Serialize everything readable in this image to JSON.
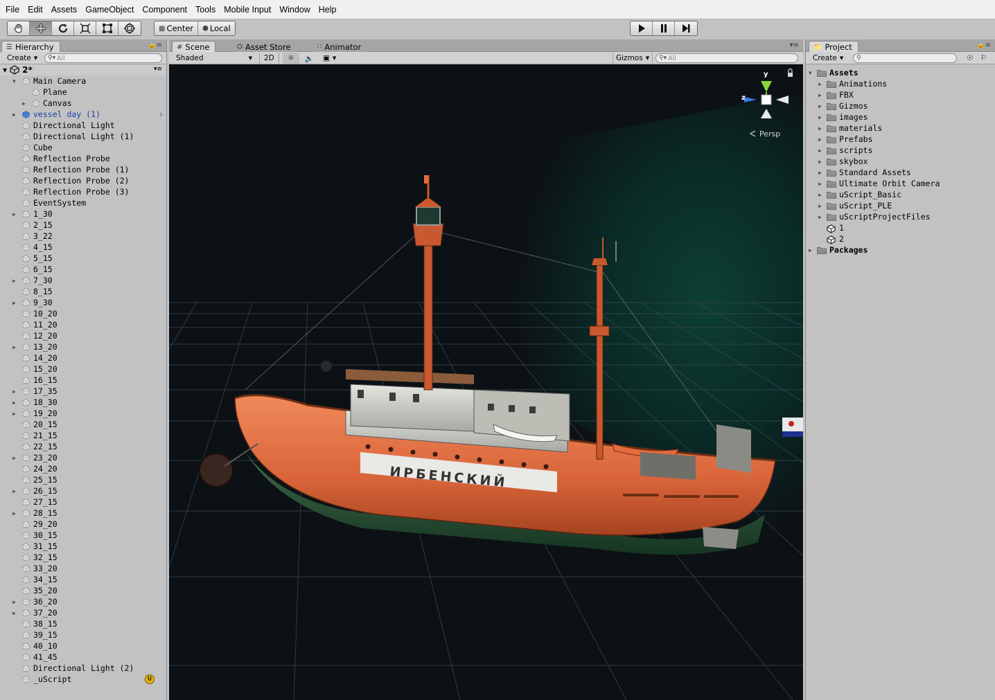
{
  "menu": [
    "File",
    "Edit",
    "Assets",
    "GameObject",
    "Component",
    "Tools",
    "Mobile Input",
    "Window",
    "Help"
  ],
  "toolbar": {
    "tools": [
      "hand-icon",
      "move-icon",
      "rotate-icon",
      "scale-icon",
      "rect-icon",
      "transform-icon"
    ],
    "pivot": "Center",
    "space": "Local",
    "playback": [
      "play-icon",
      "pause-icon",
      "step-icon"
    ]
  },
  "hierarchy": {
    "tab": "Hierarchy",
    "create": "Create",
    "search_placeholder": "All",
    "scene_name": "2*",
    "items": [
      {
        "label": "Main Camera",
        "depth": 0,
        "fold": "open"
      },
      {
        "label": "Plane",
        "depth": 1,
        "fold": ""
      },
      {
        "label": "Canvas",
        "depth": 1,
        "fold": "closed"
      },
      {
        "label": "vessel day (1)",
        "depth": 0,
        "fold": "closed",
        "prefab": true
      },
      {
        "label": "Directional Light",
        "depth": 0,
        "fold": ""
      },
      {
        "label": "Directional Light (1)",
        "depth": 0,
        "fold": ""
      },
      {
        "label": "Cube",
        "depth": 0,
        "fold": ""
      },
      {
        "label": "Reflection Probe",
        "depth": 0,
        "fold": ""
      },
      {
        "label": "Reflection Probe (1)",
        "depth": 0,
        "fold": ""
      },
      {
        "label": "Reflection Probe (2)",
        "depth": 0,
        "fold": ""
      },
      {
        "label": "Reflection Probe (3)",
        "depth": 0,
        "fold": ""
      },
      {
        "label": "EventSystem",
        "depth": 0,
        "fold": ""
      },
      {
        "label": "1_30",
        "depth": 0,
        "fold": "closed"
      },
      {
        "label": "2_15",
        "depth": 0,
        "fold": ""
      },
      {
        "label": "3_22",
        "depth": 0,
        "fold": ""
      },
      {
        "label": "4_15",
        "depth": 0,
        "fold": ""
      },
      {
        "label": "5_15",
        "depth": 0,
        "fold": ""
      },
      {
        "label": "6_15",
        "depth": 0,
        "fold": ""
      },
      {
        "label": "7_30",
        "depth": 0,
        "fold": "closed"
      },
      {
        "label": "8_15",
        "depth": 0,
        "fold": ""
      },
      {
        "label": "9_30",
        "depth": 0,
        "fold": "closed"
      },
      {
        "label": "10_20",
        "depth": 0,
        "fold": ""
      },
      {
        "label": "11_20",
        "depth": 0,
        "fold": ""
      },
      {
        "label": "12_20",
        "depth": 0,
        "fold": ""
      },
      {
        "label": "13_20",
        "depth": 0,
        "fold": "closed"
      },
      {
        "label": "14_20",
        "depth": 0,
        "fold": ""
      },
      {
        "label": "15_20",
        "depth": 0,
        "fold": ""
      },
      {
        "label": "16_15",
        "depth": 0,
        "fold": ""
      },
      {
        "label": "17_35",
        "depth": 0,
        "fold": "closed"
      },
      {
        "label": "18_30",
        "depth": 0,
        "fold": "closed"
      },
      {
        "label": "19_20",
        "depth": 0,
        "fold": "closed"
      },
      {
        "label": "20_15",
        "depth": 0,
        "fold": ""
      },
      {
        "label": "21_15",
        "depth": 0,
        "fold": ""
      },
      {
        "label": "22_15",
        "depth": 0,
        "fold": ""
      },
      {
        "label": "23_20",
        "depth": 0,
        "fold": "closed"
      },
      {
        "label": "24_20",
        "depth": 0,
        "fold": ""
      },
      {
        "label": "25_15",
        "depth": 0,
        "fold": ""
      },
      {
        "label": "26_15",
        "depth": 0,
        "fold": "closed"
      },
      {
        "label": "27_15",
        "depth": 0,
        "fold": ""
      },
      {
        "label": "28_15",
        "depth": 0,
        "fold": "closed"
      },
      {
        "label": "29_20",
        "depth": 0,
        "fold": ""
      },
      {
        "label": "30_15",
        "depth": 0,
        "fold": ""
      },
      {
        "label": "31_15",
        "depth": 0,
        "fold": ""
      },
      {
        "label": "32_15",
        "depth": 0,
        "fold": ""
      },
      {
        "label": "33_20",
        "depth": 0,
        "fold": ""
      },
      {
        "label": "34_15",
        "depth": 0,
        "fold": ""
      },
      {
        "label": "35_20",
        "depth": 0,
        "fold": ""
      },
      {
        "label": "36_20",
        "depth": 0,
        "fold": "closed"
      },
      {
        "label": "37_20",
        "depth": 0,
        "fold": "closed"
      },
      {
        "label": "38_15",
        "depth": 0,
        "fold": ""
      },
      {
        "label": "39_15",
        "depth": 0,
        "fold": ""
      },
      {
        "label": "40_10",
        "depth": 0,
        "fold": ""
      },
      {
        "label": "41_45",
        "depth": 0,
        "fold": ""
      },
      {
        "label": "Directional Light (2)",
        "depth": 0,
        "fold": ""
      },
      {
        "label": "_uScript",
        "depth": 0,
        "fold": "",
        "badge": "U"
      }
    ]
  },
  "scene": {
    "tabs": [
      {
        "label": "Scene",
        "icon": "grid-icon"
      },
      {
        "label": "Asset Store",
        "icon": "store-icon"
      },
      {
        "label": "Animator",
        "icon": "animator-icon"
      }
    ],
    "shading": "Shaded",
    "mode_2d": "2D",
    "gizmos": "Gizmos",
    "search_placeholder": "All",
    "gizmo": {
      "y": "y",
      "z": "z",
      "projection": "Persp"
    },
    "ship_name": "ИРБЕНСКИЙ"
  },
  "project": {
    "tab": "Project",
    "create": "Create",
    "items": [
      {
        "label": "Assets",
        "depth": 0,
        "type": "folder",
        "fold": "open",
        "bold": true
      },
      {
        "label": "Animations",
        "depth": 1,
        "type": "folder",
        "fold": "closed"
      },
      {
        "label": "FBX",
        "depth": 1,
        "type": "folder",
        "fold": "closed"
      },
      {
        "label": "Gizmos",
        "depth": 1,
        "type": "folder",
        "fold": "closed"
      },
      {
        "label": "images",
        "depth": 1,
        "type": "folder",
        "fold": "closed"
      },
      {
        "label": "materials",
        "depth": 1,
        "type": "folder",
        "fold": "closed"
      },
      {
        "label": "Prefabs",
        "depth": 1,
        "type": "folder",
        "fold": "closed"
      },
      {
        "label": "scripts",
        "depth": 1,
        "type": "folder",
        "fold": "closed"
      },
      {
        "label": "skybox",
        "depth": 1,
        "type": "folder",
        "fold": "closed"
      },
      {
        "label": "Standard Assets",
        "depth": 1,
        "type": "folder",
        "fold": "closed"
      },
      {
        "label": "Ultimate Orbit Camera",
        "depth": 1,
        "type": "folder",
        "fold": "closed"
      },
      {
        "label": "uScript_Basic",
        "depth": 1,
        "type": "folder",
        "fold": "closed"
      },
      {
        "label": "uScript_PLE",
        "depth": 1,
        "type": "folder",
        "fold": "closed"
      },
      {
        "label": "uScriptProjectFiles",
        "depth": 1,
        "type": "folder",
        "fold": "closed"
      },
      {
        "label": "1",
        "depth": 1,
        "type": "scene",
        "fold": ""
      },
      {
        "label": "2",
        "depth": 1,
        "type": "scene",
        "fold": ""
      },
      {
        "label": "Packages",
        "depth": 0,
        "type": "folder",
        "fold": "closed",
        "bold": true
      }
    ]
  },
  "colors": {
    "panel": "#c2c2c2",
    "viewport": "#0c1115",
    "hull": "#d9643a",
    "prefab_text": "#1b3ea8",
    "gizmo_y": "#8bd43a",
    "gizmo_x": "#e64a3a",
    "gizmo_z": "#3a7ae6"
  }
}
